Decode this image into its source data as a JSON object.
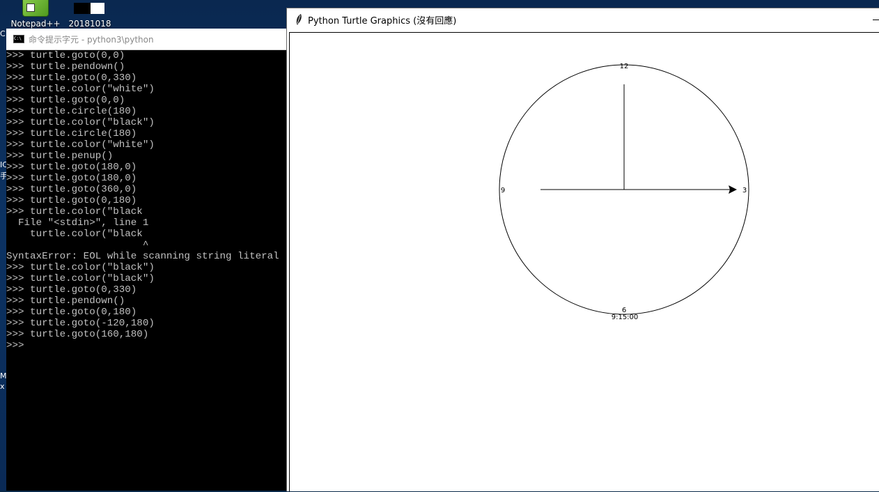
{
  "desktop": {
    "icons": [
      {
        "label": "Notepad++"
      },
      {
        "label": "20181018"
      }
    ],
    "edge_chars": [
      "C",
      "IC",
      "手",
      "M",
      "x"
    ]
  },
  "cmd": {
    "title": "命令提示字元 - python3\\python",
    "lines": [
      ">>> turtle.goto(0,0)",
      ">>> turtle.pendown()",
      ">>> turtle.goto(0,330)",
      ">>> turtle.color(\"white\")",
      ">>> turtle.goto(0,0)",
      ">>> turtle.circle(180)",
      ">>> turtle.color(\"black\")",
      ">>> turtle.circle(180)",
      ">>> turtle.color(\"white\")",
      ">>> turtle.penup()",
      ">>> turtle.goto(180,0)",
      ">>> turtle.goto(180,0)",
      ">>> turtle.goto(360,0)",
      ">>> turtle.goto(0,180)",
      ">>> turtle.color(\"black",
      "  File \"<stdin>\", line 1",
      "    turtle.color(\"black",
      "                       ^",
      "SyntaxError: EOL while scanning string literal",
      ">>> turtle.color(\"black\")",
      ">>> turtle.color(\"black\")",
      ">>> turtle.goto(0,330)",
      ">>> turtle.pendown()",
      ">>> turtle.goto(0,180)",
      ">>> turtle.goto(-120,180)",
      ">>> turtle.goto(160,180)",
      ">>>"
    ]
  },
  "turtle": {
    "title": "Python Turtle Graphics (沒有回應)",
    "clock": {
      "numbers": {
        "twelve": "12",
        "three": "3",
        "six": "6",
        "nine": "9"
      },
      "time_text": "9:15:00"
    }
  },
  "colors": {
    "cmd_text": "#c0c0c0",
    "cmd_background": "#000000",
    "desktop": "#0c3363"
  }
}
